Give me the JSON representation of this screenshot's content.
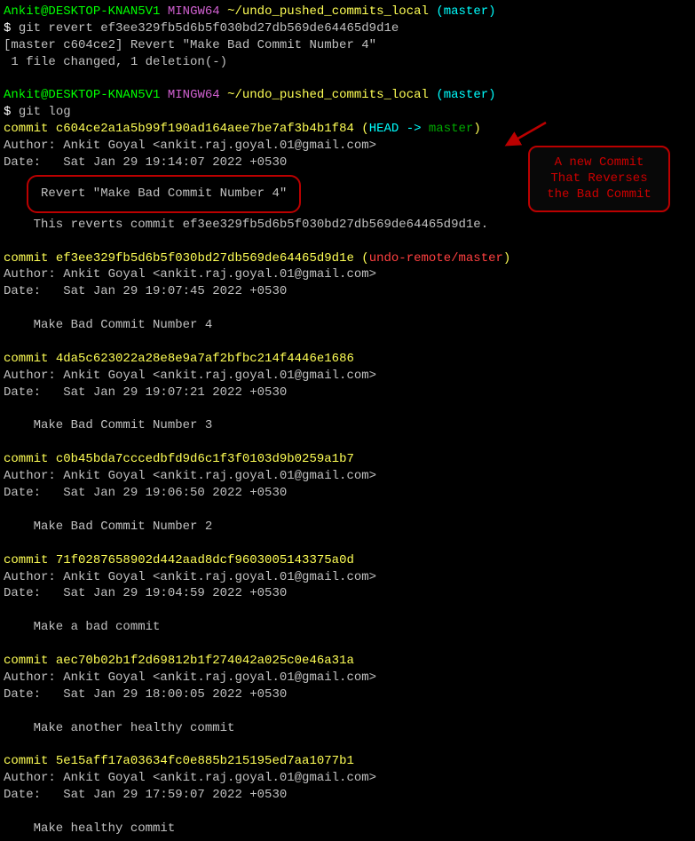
{
  "prompt": {
    "user": "Ankit",
    "at": "@",
    "host": "DESKTOP-KNAN5V1",
    "env": "MINGW64",
    "path": "~/undo_pushed_commits_local",
    "branch": "(master)"
  },
  "revert": {
    "cmd_prefix": "$ ",
    "cmd": "git revert ef3ee329fb5d6b5f030bd27db569de64465d9d1e",
    "out1": "[master c604ce2] Revert \"Make Bad Commit Number 4\"",
    "out2": " 1 file changed, 1 deletion(-)"
  },
  "log_cmd_prefix": "$ ",
  "log_cmd": "git log",
  "head_commit": {
    "prefix": "commit ",
    "hash": "c604ce2a1a5b99f190ad164aee7be7af3b4b1f84",
    "paren_open": " (",
    "head_label": "HEAD -> ",
    "branch": "master",
    "paren_close": ")",
    "author": "Author: Ankit Goyal <ankit.raj.goyal.01@gmail.com>",
    "date": "Date:   Sat Jan 29 19:14:07 2022 +0530",
    "msg": "Revert \"Make Bad Commit Number 4\"",
    "msg2": "    This reverts commit ef3ee329fb5d6b5f030bd27db569de64465d9d1e."
  },
  "annotation": {
    "text": "A new Commit That Reverses the Bad Commit"
  },
  "commits": [
    {
      "prefix": "commit ",
      "hash": "ef3ee329fb5d6b5f030bd27db569de64465d9d1e",
      "paren_open": " (",
      "ref": "undo-remote/master",
      "paren_close": ")",
      "author": "Author: Ankit Goyal <ankit.raj.goyal.01@gmail.com>",
      "date": "Date:   Sat Jan 29 19:07:45 2022 +0530",
      "msg": "    Make Bad Commit Number 4"
    },
    {
      "prefix": "commit ",
      "hash": "4da5c623022a28e8e9a7af2bfbc214f4446e1686",
      "author": "Author: Ankit Goyal <ankit.raj.goyal.01@gmail.com>",
      "date": "Date:   Sat Jan 29 19:07:21 2022 +0530",
      "msg": "    Make Bad Commit Number 3"
    },
    {
      "prefix": "commit ",
      "hash": "c0b45bda7cccedbfd9d6c1f3f0103d9b0259a1b7",
      "author": "Author: Ankit Goyal <ankit.raj.goyal.01@gmail.com>",
      "date": "Date:   Sat Jan 29 19:06:50 2022 +0530",
      "msg": "    Make Bad Commit Number 2"
    },
    {
      "prefix": "commit ",
      "hash": "71f0287658902d442aad8dcf9603005143375a0d",
      "author": "Author: Ankit Goyal <ankit.raj.goyal.01@gmail.com>",
      "date": "Date:   Sat Jan 29 19:04:59 2022 +0530",
      "msg": "    Make a bad commit"
    },
    {
      "prefix": "commit ",
      "hash": "aec70b02b1f2d69812b1f274042a025c0e46a31a",
      "author": "Author: Ankit Goyal <ankit.raj.goyal.01@gmail.com>",
      "date": "Date:   Sat Jan 29 18:00:05 2022 +0530",
      "msg": "    Make another healthy commit"
    },
    {
      "prefix": "commit ",
      "hash": "5e15aff17a03634fc0e885b215195ed7aa1077b1",
      "author": "Author: Ankit Goyal <ankit.raj.goyal.01@gmail.com>",
      "date": "Date:   Sat Jan 29 17:59:07 2022 +0530",
      "msg": "    Make healthy commit"
    }
  ]
}
